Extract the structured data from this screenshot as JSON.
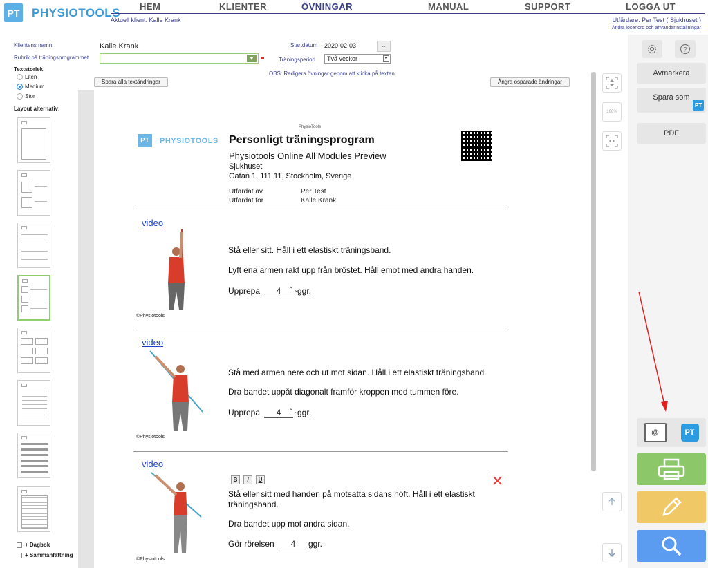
{
  "brand": {
    "badge": "PT",
    "name": "PHYSIOTOOLS"
  },
  "nav": {
    "home": "HEM",
    "clients": "KLIENTER",
    "exercises": "ÖVNINGAR",
    "manual": "MANUAL",
    "support": "SUPPORT",
    "logout": "LOGGA UT"
  },
  "header": {
    "current_client": "Aktuell klient: Kalle Krank",
    "issuer": "Utfärdare: Per Test ( Sjukhuset )",
    "password_link": "Ändra lösenord och användarinställningar"
  },
  "form": {
    "client_name_label": "Klientens namn:",
    "client_name_value": "Kalle  Krank",
    "title_label": "Rubrik på träningsprogrammet",
    "start_label": "Startdatum",
    "start_value": "2020-02-03",
    "dots_button": "..",
    "period_label": "Träningsperiod",
    "period_value": "Två veckor",
    "obs_text": "OBS: Redigera övningar genom att klicka på texten",
    "save_all_button": "Spara alla textändringar",
    "undo_button": "Ångra osparade ändringar"
  },
  "textsize": {
    "title": "Textstorlek:",
    "options": [
      "Liten",
      "Medium",
      "Stor"
    ],
    "selected": "Medium"
  },
  "layout": {
    "title": "Layout alternativ:"
  },
  "extras": {
    "diary": "+ Dagbok",
    "summary": "+ Sammanfattning"
  },
  "document": {
    "small_header": "PhysioTools",
    "logo_badge": "PT",
    "logo_text": "PHYSIOTOOLS",
    "title": "Personligt träningsprogram",
    "subtitle": "Physiotools Online All Modules Preview",
    "org": "Sjukhuset",
    "address": "Gatan 1, 111 11, Stockholm, Sverige",
    "issued_by_label": "Utfärdat av",
    "issued_by": "Per Test",
    "issued_for_label": "Utfärdat för",
    "issued_for": "Kalle Krank"
  },
  "exercises": [
    {
      "video": "video",
      "lines": [
        "Stå eller sitt. Håll i ett elastiskt träningsband.",
        "Lyft ena armen rakt upp från bröstet. Håll emot med andra handen."
      ],
      "repeat_label": "Upprepa",
      "repeat_value": "4",
      "repeat_unit": "ggr.",
      "copyright": "©Phvsiotools"
    },
    {
      "video": "video",
      "lines": [
        "Stå med armen nere och ut mot sidan. Håll i ett elastiskt träningsband.",
        "Dra bandet uppåt diagonalt framför kroppen med tummen före."
      ],
      "repeat_label": "Upprepa",
      "repeat_value": "4",
      "repeat_unit": "ggr.",
      "copyright": "©Physiotools"
    },
    {
      "video": "video",
      "lines": [
        "Stå eller sitt med handen på motsatta sidans höft. Håll i ett elastiskt träningsband.",
        "Dra bandet upp mot andra sidan."
      ],
      "repeat_label": "Gör rörelsen",
      "repeat_value": "4",
      "repeat_unit": "ggr.",
      "copyright": "©Physiotools"
    }
  ],
  "format_buttons": [
    "B",
    "I",
    "U"
  ],
  "right_panel": {
    "deselect": "Avmarkera",
    "save_as": "Spara som",
    "pdf": "PDF",
    "print_color": "#8cc86a",
    "edit_color": "#f0c866",
    "search_color": "#5b9bf0"
  },
  "tools": {
    "zoom_100": "100%"
  }
}
